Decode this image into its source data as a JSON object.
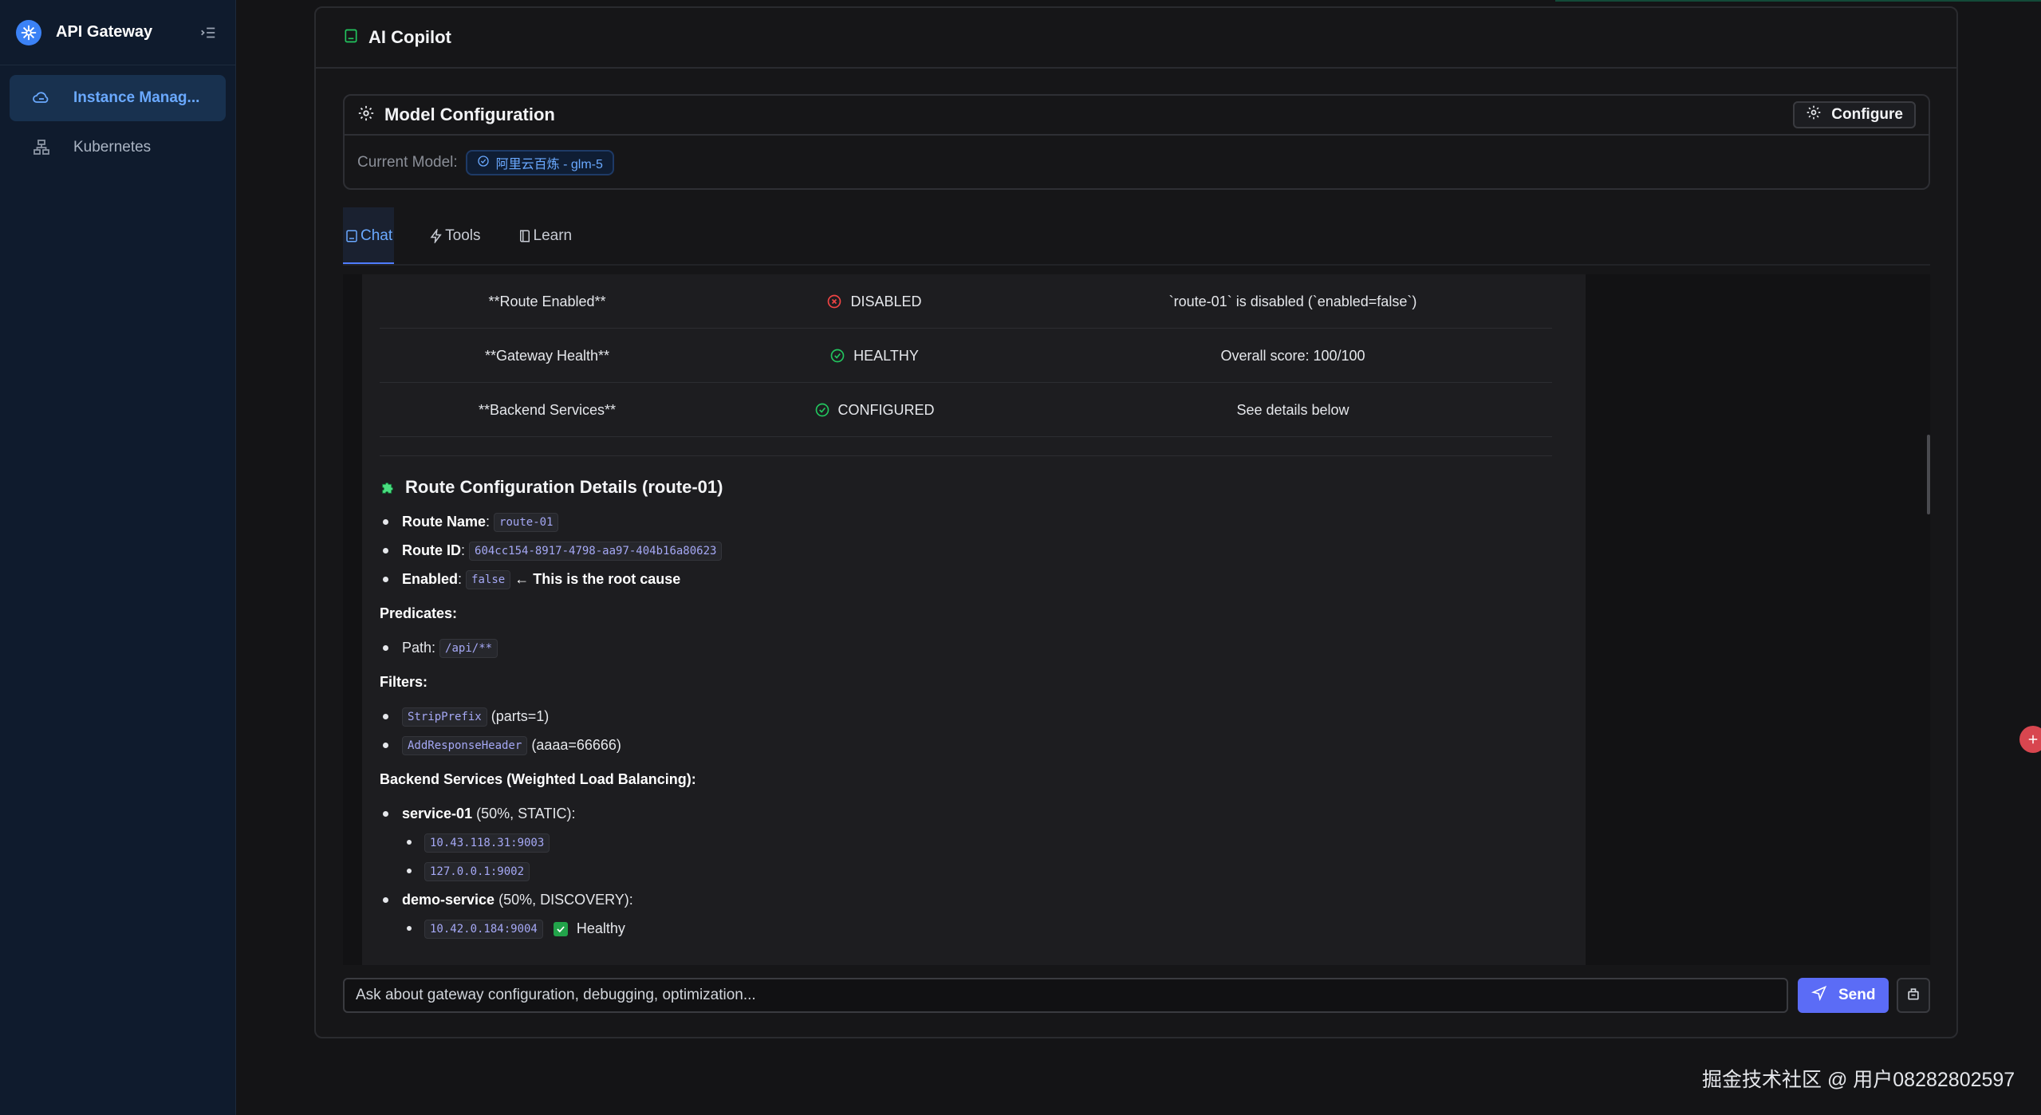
{
  "sidebar": {
    "brand": "API Gateway",
    "items": [
      {
        "label": "Instance Manag...",
        "icon": "cloud-icon",
        "active": true
      },
      {
        "label": "Kubernetes",
        "icon": "cluster-icon",
        "active": false
      }
    ]
  },
  "panel": {
    "title": "AI Copilot"
  },
  "model_config": {
    "title": "Model Configuration",
    "configure_label": "Configure",
    "current_label": "Current Model:",
    "current_model": "阿里云百炼 - glm-5"
  },
  "tabs": [
    {
      "label": "Chat",
      "active": true
    },
    {
      "label": "Tools",
      "active": false
    },
    {
      "label": "Learn",
      "active": false
    }
  ],
  "status_table": [
    {
      "item": "**Route Enabled**",
      "status": "DISABLED",
      "status_kind": "error",
      "details": "`route-01` is disabled (`enabled=false`)"
    },
    {
      "item": "**Gateway Health**",
      "status": "HEALTHY",
      "status_kind": "ok",
      "details": "Overall score: 100/100"
    },
    {
      "item": "**Backend Services**",
      "status": "CONFIGURED",
      "status_kind": "ok",
      "details": "See details below"
    }
  ],
  "route_details": {
    "title": "Route Configuration Details (route-01)",
    "route_name_label": "Route Name",
    "route_name": "route-01",
    "route_id_label": "Route ID",
    "route_id": "604cc154-8917-4798-aa97-404b16a80623",
    "enabled_label": "Enabled",
    "enabled_value": "false",
    "root_cause": "← This is the root cause",
    "predicates_label": "Predicates:",
    "path_label": "Path:",
    "path_value": "/api/**",
    "filters_label": "Filters:",
    "filters": [
      {
        "name": "StripPrefix",
        "args": "(parts=1)"
      },
      {
        "name": "AddResponseHeader",
        "args": "(aaaa=66666)"
      }
    ],
    "backend_label": "Backend Services (Weighted Load Balancing):",
    "services": [
      {
        "name": "service-01",
        "meta": "(50%, STATIC):",
        "endpoints": [
          {
            "addr": "10.43.118.31:9003",
            "note": ""
          },
          {
            "addr": "127.0.0.1:9002",
            "note": ""
          }
        ]
      },
      {
        "name": "demo-service",
        "meta": "(50%, DISCOVERY):",
        "endpoints": [
          {
            "addr": "10.42.0.184:9004",
            "note": "Healthy"
          }
        ]
      }
    ]
  },
  "input": {
    "placeholder": "Ask about gateway configuration, debugging, optimization...",
    "send_label": "Send"
  },
  "watermark": "掘金技术社区 @ 用户08282802597",
  "colors": {
    "accent": "#5b6cf6",
    "link": "#6aa9ff",
    "success": "#22c55e",
    "error": "#ef4444"
  }
}
